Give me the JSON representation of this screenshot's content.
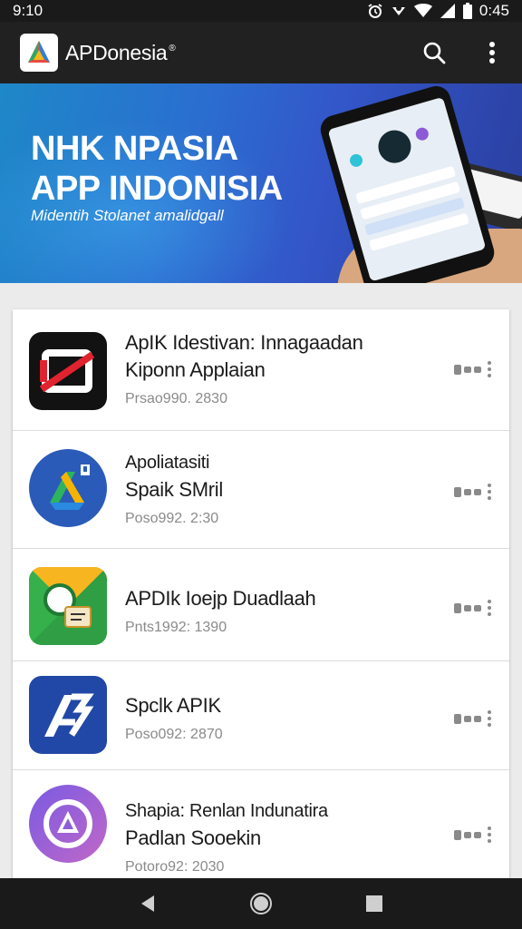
{
  "status_bar": {
    "time_left": "9:10",
    "time_right": "0:45",
    "icons": [
      "alarm-icon",
      "vibrate-icon",
      "wifi-icon",
      "signal-icon",
      "battery-icon"
    ]
  },
  "app_bar": {
    "title": "APDonesia",
    "title_mark": "®",
    "actions": [
      "search-icon",
      "more-vert-icon"
    ]
  },
  "banner": {
    "title_line1": "NHK NPASIA",
    "title_line2": "APP INDONISIA",
    "subtitle": "Midentih Stolanet amalidgall"
  },
  "apps": [
    {
      "name_line1": "ApIK Idestivan: Innagaadan",
      "name_line2": "Kiponn Applaian",
      "meta": "Prsao990. 2830",
      "icon": "red-slash-app-icon"
    },
    {
      "name_line1": "Apoliatasiti",
      "name_line2": "Spaik SMril",
      "meta": "Poso992. 2:30",
      "icon": "drive-like-app-icon"
    },
    {
      "name_line1": "APDIk Ioejp Duadlaah",
      "name_line2": "",
      "meta": "Pnts1992: 1390",
      "icon": "chat-yellow-app-icon"
    },
    {
      "name_line1": "Spclk APIK",
      "name_line2": "",
      "meta": "Poso092: 2870",
      "icon": "letter-a-app-icon"
    },
    {
      "name_line1": "Shapia: Renlan Indunatira",
      "name_line2": "Padlan Sooekin",
      "meta": "Potoro92: 2030",
      "icon": "purple-triangle-app-icon"
    }
  ],
  "colors": {
    "status_bar": "#1a1a1a",
    "app_bar": "#212121",
    "banner_blue": "#2a6fd0",
    "list_bg": "#ffffff",
    "meta_text": "#8a8a8a"
  },
  "nav_bar": {
    "icons": [
      "back-icon",
      "home-icon",
      "recents-icon"
    ]
  }
}
